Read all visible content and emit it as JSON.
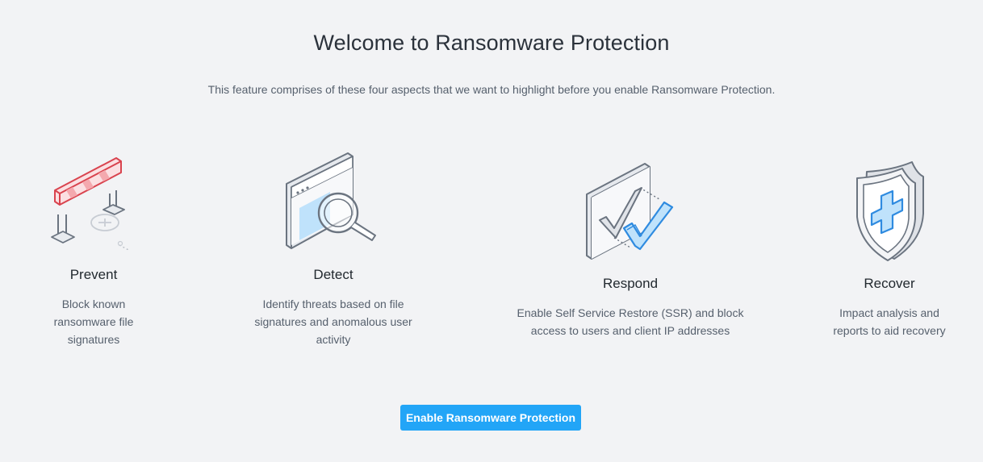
{
  "header": {
    "title": "Welcome to Ransomware Protection",
    "subtitle": "This feature comprises of these four aspects that we want to highlight before you enable Ransomware Protection."
  },
  "features": [
    {
      "icon": "barrier-icon",
      "name": "Prevent",
      "description": "Block known ransomware file signatures"
    },
    {
      "icon": "magnifier-window-icon",
      "name": "Detect",
      "description": "Identify threats based on file signatures and anomalous user activity"
    },
    {
      "icon": "checkmark-icon",
      "name": "Respond",
      "description": "Enable Self Service Restore (SSR) and block access to users and client IP addresses"
    },
    {
      "icon": "shield-plus-icon",
      "name": "Recover",
      "description": "Impact analysis and reports to aid recovery"
    }
  ],
  "action": {
    "enable_label": "Enable Ransomware Protection"
  },
  "colors": {
    "background": "#f2f3f5",
    "accent": "#22a5f7",
    "danger": "#d9434e",
    "icon_blue": "#2f8be0"
  }
}
